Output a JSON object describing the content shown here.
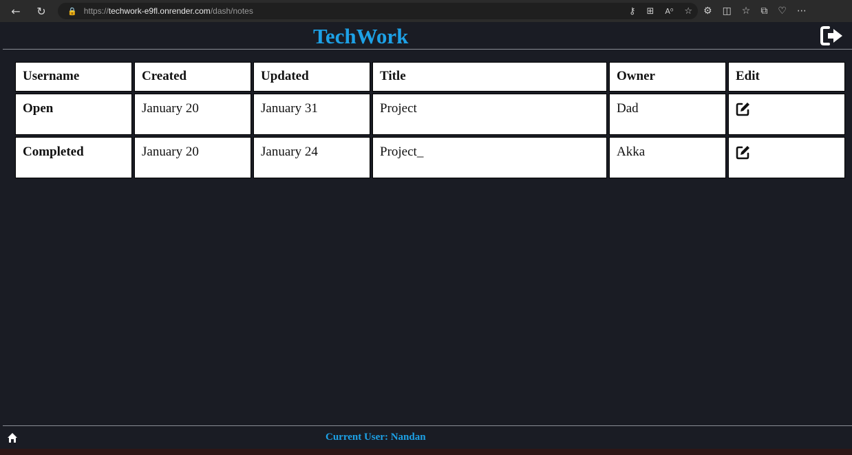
{
  "browser": {
    "url_scheme": "https://",
    "url_host": "techwork-e9fl.onrender.com",
    "url_path": "/dash/notes"
  },
  "app": {
    "brand": "TechWork",
    "accent_color": "#1da1e6",
    "logout_icon": "logout-icon"
  },
  "table": {
    "headers": [
      "Username",
      "Created",
      "Updated",
      "Title",
      "Owner",
      "Edit"
    ],
    "rows": [
      {
        "status": "Open",
        "created": "January 20",
        "updated": "January 31",
        "title": "Project",
        "owner": "Dad"
      },
      {
        "status": "Completed",
        "created": "January 20",
        "updated": "January 24",
        "title": "Project_",
        "owner": "Akka"
      }
    ],
    "status_colors": {
      "open": "#b5282e",
      "completed": "#3cc24a"
    },
    "edit_icon": "edit-icon"
  },
  "footer": {
    "current_user": "Current User: Nandan",
    "home_icon": "home-icon"
  }
}
